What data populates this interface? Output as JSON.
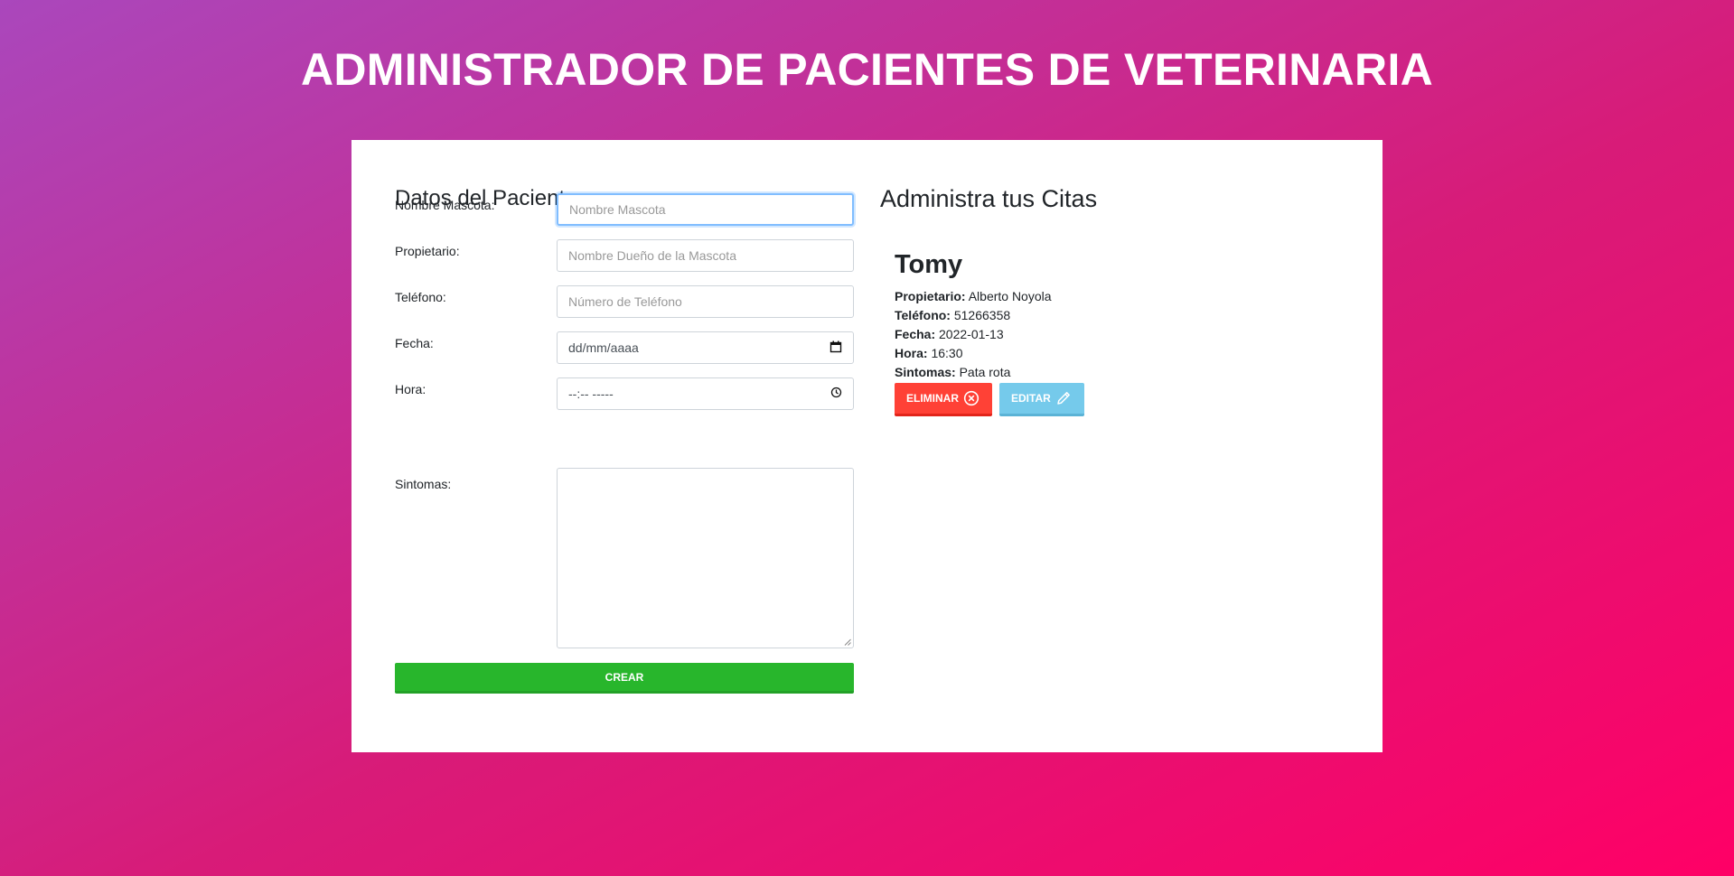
{
  "header": {
    "title": "ADMINISTRADOR DE PACIENTES DE VETERINARIA"
  },
  "form": {
    "title": "Datos del Paciente",
    "fields": [
      {
        "label": "Nombre Mascota:",
        "placeholder": "Nombre Mascota",
        "value": ""
      },
      {
        "label": "Propietario:",
        "placeholder": "Nombre Dueño de la Mascota",
        "value": ""
      },
      {
        "label": "Teléfono:",
        "placeholder": "Número de Teléfono",
        "value": ""
      },
      {
        "label": "Fecha:",
        "placeholder": "dd/mm/aaaa",
        "value": "",
        "icon": "calendar-icon"
      },
      {
        "label": "Hora:",
        "placeholder": "--:-- -----",
        "value": "",
        "icon": "clock-icon"
      },
      {
        "label": "Sintomas:",
        "placeholder": "",
        "value": ""
      }
    ],
    "submit_label": "CREAR"
  },
  "list": {
    "title": "Administra tus Citas",
    "appointments": [
      {
        "pet": "Tomy",
        "owner_label": "Propietario:",
        "owner": "Alberto Noyola",
        "phone_label": "Teléfono:",
        "phone": "51266358",
        "date_label": "Fecha:",
        "date": "2022-01-13",
        "time_label": "Hora:",
        "time": "16:30",
        "symptoms_label": "Sintomas:",
        "symptoms": "Pata rota",
        "delete_label": "ELIMINAR",
        "delete_icon": "x-circle-icon",
        "edit_label": "EDITAR",
        "edit_icon": "pencil-icon"
      }
    ]
  },
  "colors": {
    "gradient_start": "#AA47BC",
    "gradient_end": "#FF0066",
    "submit": "#28b62c",
    "delete": "#FF4136",
    "edit": "#75CAEB"
  }
}
